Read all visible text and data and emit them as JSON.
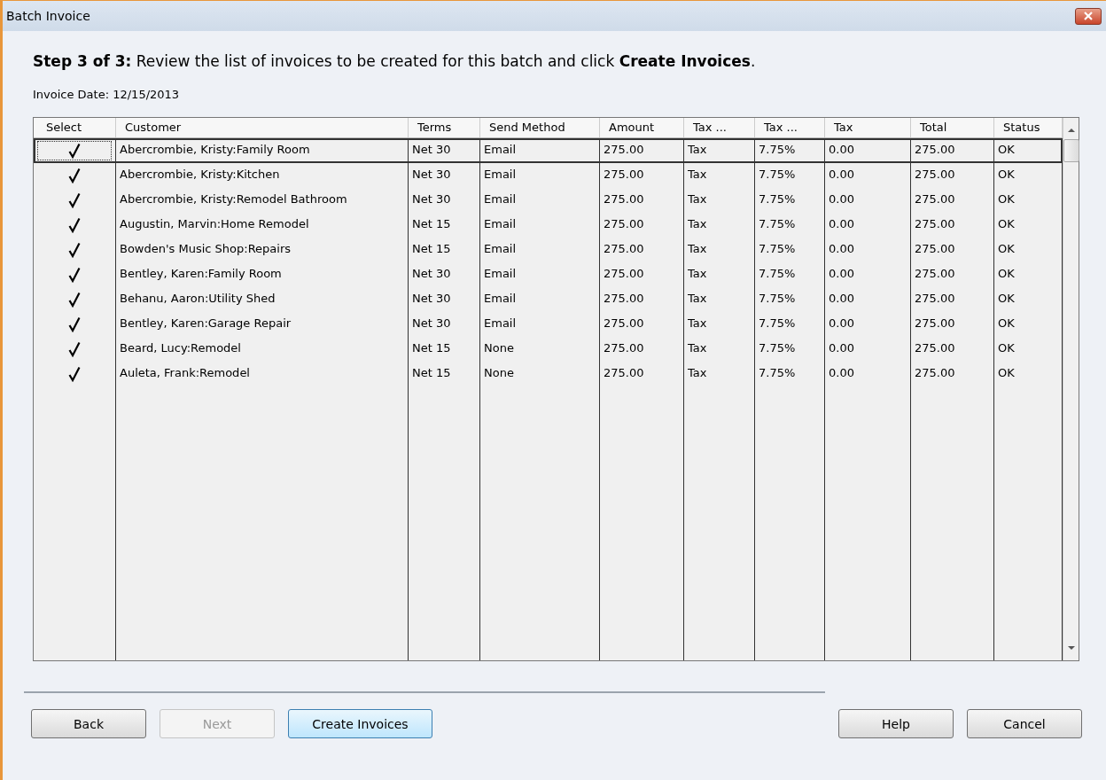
{
  "window": {
    "title": "Batch Invoice"
  },
  "instruction": "**Step 3 of 3:** Review the list of invoices to be created for this batch and click **Create Invoices**.",
  "invoice_date": "Invoice Date: 12/15/2013",
  "table": {
    "select_column": "Select",
    "columns": [
      "Customer",
      "Terms",
      "Send Method",
      "Amount",
      "Tax ...",
      "Tax ...",
      "Tax",
      "Total",
      "Status"
    ],
    "rows": [
      {
        "checked": true,
        "selected": true,
        "cells": [
          "Abercrombie, Kristy:Family Room",
          "Net 30",
          "Email",
          "275.00",
          "Tax",
          "7.75%",
          "0.00",
          "275.00",
          "OK"
        ]
      },
      {
        "checked": true,
        "selected": false,
        "cells": [
          "Abercrombie, Kristy:Kitchen",
          "Net 30",
          "Email",
          "275.00",
          "Tax",
          "7.75%",
          "0.00",
          "275.00",
          "OK"
        ]
      },
      {
        "checked": true,
        "selected": false,
        "cells": [
          "Abercrombie, Kristy:Remodel Bathroom",
          "Net 30",
          "Email",
          "275.00",
          "Tax",
          "7.75%",
          "0.00",
          "275.00",
          "OK"
        ]
      },
      {
        "checked": true,
        "selected": false,
        "cells": [
          "Augustin, Marvin:Home Remodel",
          "Net 15",
          "Email",
          "275.00",
          "Tax",
          "7.75%",
          "0.00",
          "275.00",
          "OK"
        ]
      },
      {
        "checked": true,
        "selected": false,
        "cells": [
          "Bowden's Music Shop:Repairs",
          "Net 15",
          "Email",
          "275.00",
          "Tax",
          "7.75%",
          "0.00",
          "275.00",
          "OK"
        ]
      },
      {
        "checked": true,
        "selected": false,
        "cells": [
          "Bentley, Karen:Family Room",
          "Net 30",
          "Email",
          "275.00",
          "Tax",
          "7.75%",
          "0.00",
          "275.00",
          "OK"
        ]
      },
      {
        "checked": true,
        "selected": false,
        "cells": [
          "Behanu, Aaron:Utility Shed",
          "Net 30",
          "Email",
          "275.00",
          "Tax",
          "7.75%",
          "0.00",
          "275.00",
          "OK"
        ]
      },
      {
        "checked": true,
        "selected": false,
        "cells": [
          "Bentley, Karen:Garage Repair",
          "Net 30",
          "Email",
          "275.00",
          "Tax",
          "7.75%",
          "0.00",
          "275.00",
          "OK"
        ]
      },
      {
        "checked": true,
        "selected": false,
        "cells": [
          "Beard, Lucy:Remodel",
          "Net 15",
          "None",
          "275.00",
          "Tax",
          "7.75%",
          "0.00",
          "275.00",
          "OK"
        ]
      },
      {
        "checked": true,
        "selected": false,
        "cells": [
          "Auleta, Frank:Remodel",
          "Net 15",
          "None",
          "275.00",
          "Tax",
          "7.75%",
          "0.00",
          "275.00",
          "OK"
        ]
      }
    ]
  },
  "left_buttons": [
    {
      "label": "Back",
      "disabled": false,
      "focused": false
    },
    {
      "label": "Next",
      "disabled": true,
      "focused": false
    },
    {
      "label": "Create Invoices",
      "disabled": false,
      "focused": true
    }
  ],
  "right_buttons": [
    {
      "label": "Help",
      "disabled": false,
      "focused": false
    },
    {
      "label": "Cancel",
      "disabled": false,
      "focused": false
    }
  ]
}
